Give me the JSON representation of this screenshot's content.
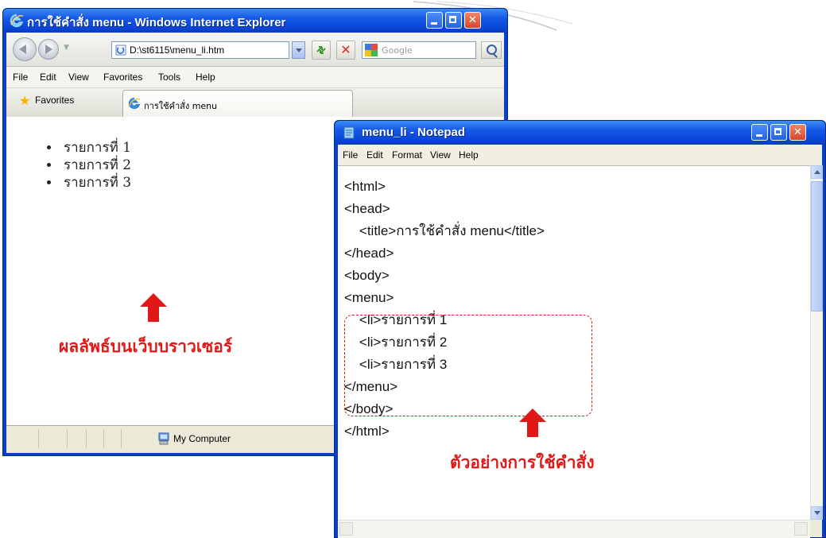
{
  "ie": {
    "title": "การใช้คำสั่ง menu - Windows Internet Explorer",
    "address": "D:\\st6115\\menu_li.htm",
    "search_placeholder": "Google",
    "menu": [
      "File",
      "Edit",
      "View",
      "Favorites",
      "Tools",
      "Help"
    ],
    "favorites_label": "Favorites",
    "tab_label": "การใช้คำสั่ง menu",
    "list_items": [
      "รายการที่ 1",
      "รายการที่ 2",
      "รายการที่ 3"
    ],
    "status_zone": "My Computer"
  },
  "notepad": {
    "title": "menu_li - Notepad",
    "menu": [
      "File",
      "Edit",
      "Format",
      "View",
      "Help"
    ],
    "code_lines": [
      "<html>",
      "<head>",
      "    <title>การใช้คำสั่ง menu</title>",
      "</head>",
      "<body>",
      "<menu>",
      "    <li>รายการที่ 1",
      "    <li>รายการที่ 2",
      "    <li>รายการที่ 3",
      "</menu>",
      "</body>",
      "</html>"
    ]
  },
  "annotations": {
    "browser_result": "ผลลัพธ์บนเว็บบราวเซอร์",
    "command_example": "ตัวอย่างการใช้คำสั่ง"
  },
  "colors": {
    "title_blue": "#1458e6",
    "annotation_red": "#e01818"
  }
}
